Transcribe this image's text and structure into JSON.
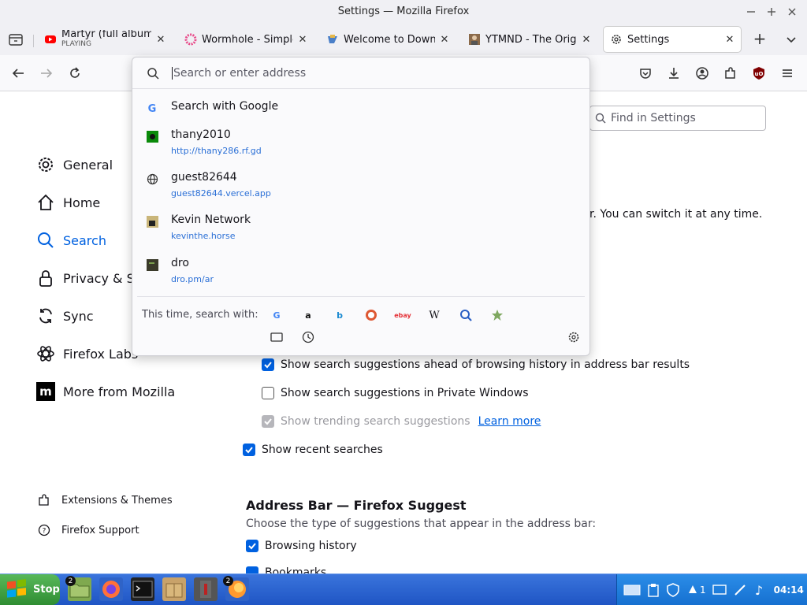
{
  "window": {
    "title": "Settings — Mozilla Firefox"
  },
  "tabs": [
    {
      "title": "Martyr (full album) -",
      "subtitle": "PLAYING"
    },
    {
      "title": "Wormhole - Simple, p"
    },
    {
      "title": "Welcome to DownTh"
    },
    {
      "title": "YTMND - The Origin"
    },
    {
      "title": "Settings"
    }
  ],
  "urlbar": {
    "placeholder": "Search or enter address"
  },
  "suggestions": {
    "search_with_google": "Search with Google",
    "items": [
      {
        "title": "thany2010",
        "url": "http://thany286.rf.gd"
      },
      {
        "title": "guest82644",
        "url": "guest82644.vercel.app"
      },
      {
        "title": "Kevin Network",
        "url": "kevinthe.horse"
      },
      {
        "title": "dro",
        "url": "dro.pm/ar"
      }
    ],
    "this_time_label": "This time, search with:"
  },
  "settings": {
    "find_placeholder": "Find in Settings",
    "partial_text": "r. You can switch it at any time.",
    "sidebar": [
      "General",
      "Home",
      "Search",
      "Privacy & Se",
      "Sync",
      "Firefox Labs",
      "More from Mozilla"
    ],
    "footer_links": [
      "Extensions & Themes",
      "Firefox Support"
    ],
    "options": {
      "suggest_ahead": "Show search suggestions ahead of browsing history in address bar results",
      "private_windows": "Show search suggestions in Private Windows",
      "trending": "Show trending search suggestions",
      "learn_more": "Learn more",
      "recent": "Show recent searches"
    },
    "address_bar_heading": "Address Bar — Firefox Suggest",
    "address_bar_desc": "Choose the type of suggestions that appear in the address bar:",
    "browsing_history": "Browsing history",
    "bookmarks": "Bookmarks"
  },
  "taskbar": {
    "start_label": "Stop",
    "files_badge": "2",
    "firefox_badge": "2",
    "tray_count": "1",
    "clock": "04:14"
  },
  "colors": {
    "accent": "#0061e0",
    "link": "#2a6fd6",
    "taskbar": "#245edb",
    "start": "#3c9a3f"
  }
}
